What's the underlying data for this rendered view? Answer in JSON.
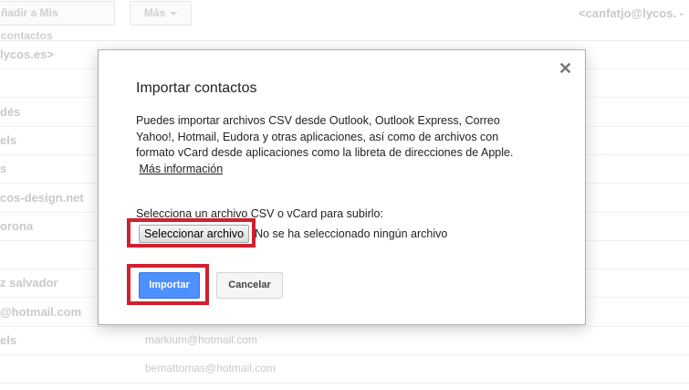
{
  "background": {
    "toolbar": {
      "add_contacts_label": "ñadir a Mis contactos",
      "more_label": "Más",
      "user_label": "<canfatjo@lycos. -"
    },
    "rows": [
      {
        "name": "lycos.es>",
        "email": ""
      },
      {
        "name": "",
        "email": ""
      },
      {
        "name": "dés",
        "email": ""
      },
      {
        "name": "els",
        "email": ""
      },
      {
        "name": "s",
        "email": ""
      },
      {
        "name": "cos-design.net",
        "email": ""
      },
      {
        "name": "orona",
        "email": ""
      },
      {
        "name": "",
        "email": ""
      },
      {
        "name": "z salvador",
        "email": ""
      },
      {
        "name": "@hotmail.com",
        "email": ""
      },
      {
        "name": "els",
        "email": "markium@hotmail.com"
      },
      {
        "name": "",
        "email": "bemattomas@hotmail.com"
      }
    ]
  },
  "dialog": {
    "title": "Importar contactos",
    "close_icon": "close-icon",
    "description": "Puedes importar archivos CSV desde Outlook, Outlook Express, Correo Yahoo!, Hotmail, Eudora y otras aplicaciones, así como de archivos con formato vCard desde aplicaciones como la libreta de direcciones de Apple.",
    "more_info_link": "Más información",
    "select_label": "Selecciona un archivo CSV o vCard para subirlo:",
    "file_button": "Seleccionar archivo",
    "file_status": "No se ha seleccionado ningún archivo",
    "import_button": "Importar",
    "cancel_button": "Cancelar"
  },
  "colors": {
    "highlight": "#d0202e",
    "primary": "#4d90fe"
  }
}
